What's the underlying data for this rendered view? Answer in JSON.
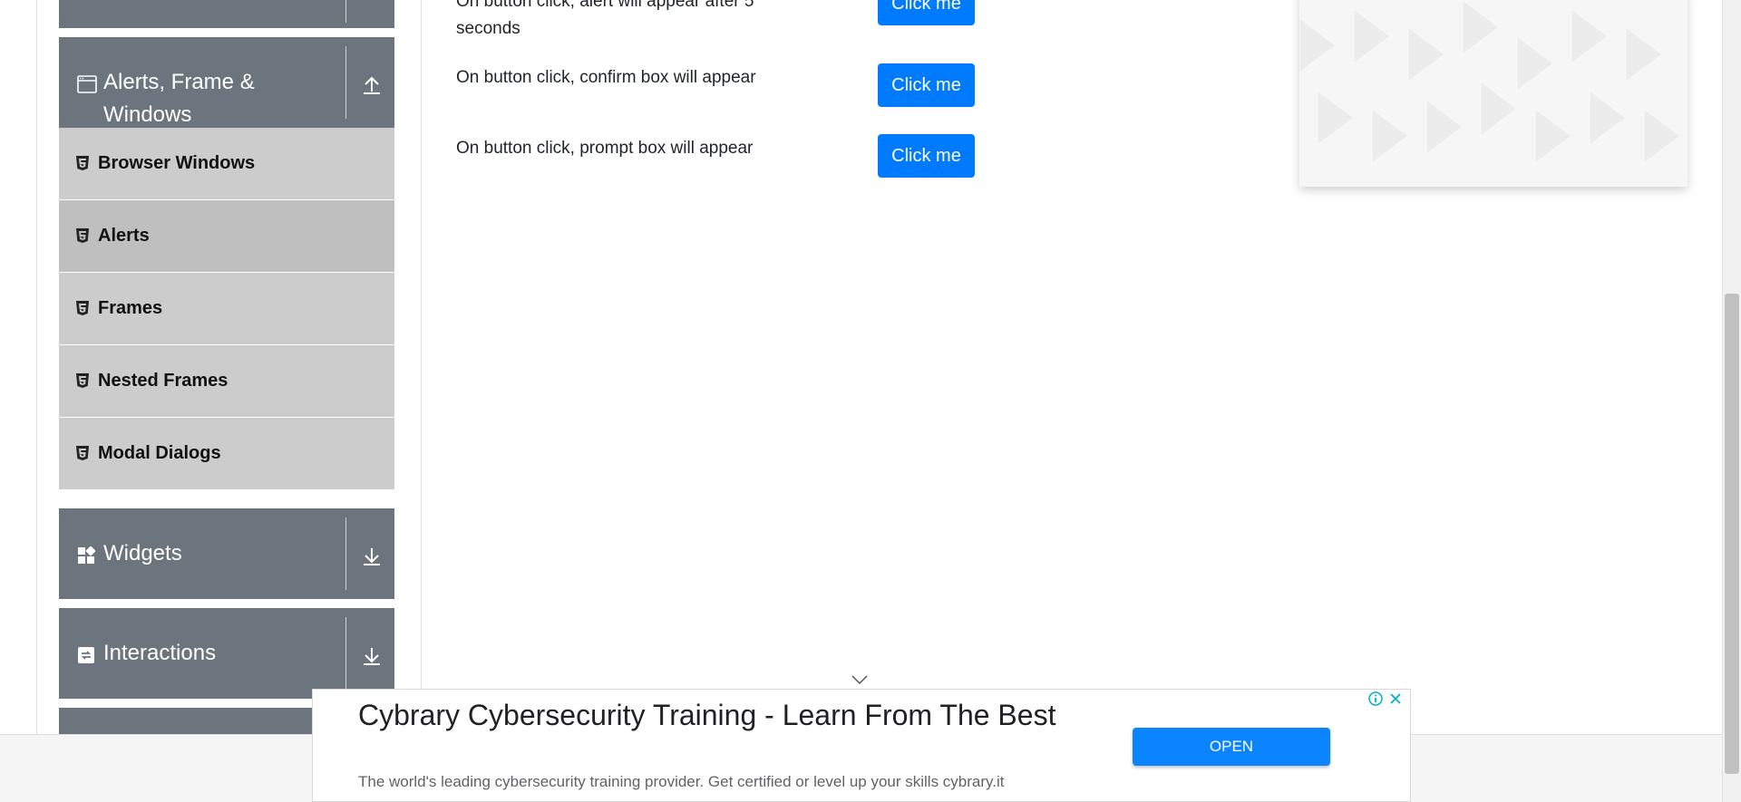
{
  "sidebar": {
    "alerts_group": {
      "title_line1": "Alerts, Frame &",
      "title_line2": "Windows"
    },
    "items": [
      {
        "label": "Browser Windows"
      },
      {
        "label": "Alerts"
      },
      {
        "label": "Frames"
      },
      {
        "label": "Nested Frames"
      },
      {
        "label": "Modal Dialogs"
      }
    ],
    "widgets_group": {
      "title": "Widgets"
    },
    "interactions_group": {
      "title": "Interactions"
    }
  },
  "main": {
    "rows": [
      {
        "text_line1": "On button click, alert will appear after 5",
        "text_line2": "seconds",
        "button": "Click me"
      },
      {
        "text": "On button click, confirm box will appear",
        "button": "Click me"
      },
      {
        "text": "On button click, prompt box will appear",
        "button": "Click me"
      }
    ]
  },
  "ad": {
    "title": "Cybrary Cybersecurity Training - Learn From The Best",
    "description": "The world's leading cybersecurity training provider. Get certified or level up your skills cybrary.it",
    "open_label": "OPEN"
  },
  "colors": {
    "header_gray": "#6c757d",
    "menu_gray": "#cccccc",
    "menu_active": "#bfbfbf",
    "primary": "#007bff"
  }
}
